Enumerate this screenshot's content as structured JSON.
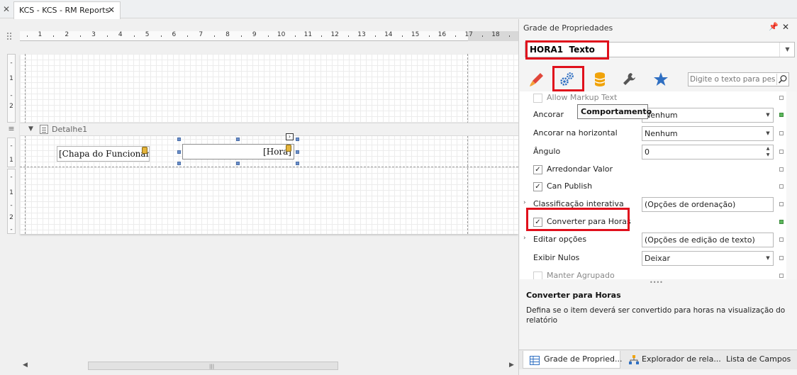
{
  "document_tab": {
    "label": "KCS - KCS - RM Reports",
    "close_glyph": "✕"
  },
  "ruler": {
    "numbers": [
      "1",
      "2",
      "3",
      "4",
      "5",
      "6",
      "7",
      "8",
      "9",
      "10",
      "11",
      "12",
      "13",
      "14",
      "15",
      "16",
      "17",
      "18"
    ]
  },
  "vruler": {
    "top_section": [
      "-",
      "1",
      "-",
      "2"
    ],
    "detail_section": [
      "-",
      "1"
    ],
    "bottom_section": [
      "-",
      "1",
      "-",
      "2",
      "-"
    ]
  },
  "designer": {
    "band_name": "Detalhe1",
    "field_employee": "[Chapa do Funcionário]",
    "field_hours": "[Hora]"
  },
  "properties": {
    "title": "Grade de Propriedades",
    "selected_object": "HORA1  Texto",
    "search_placeholder": "Digite o texto para pesquisar...",
    "tooltip": "Comportamento",
    "rows": {
      "allow_markup": "Allow Markup Text",
      "ancorar": {
        "label": "Ancorar",
        "value": "Nenhum"
      },
      "ancorar_h": {
        "label": "Ancorar na horizontal",
        "value": "Nenhum"
      },
      "angulo": {
        "label": "Ângulo",
        "value": "0"
      },
      "arredondar": "Arredondar Valor",
      "can_publish": "Can Publish",
      "classificacao": {
        "label": "Classificação interativa",
        "value": "(Opções de ordenação)"
      },
      "converter": "Converter para Horas",
      "editar": {
        "label": "Editar opções",
        "value": "(Opções de edição de texto)"
      },
      "exibir_nulos": {
        "label": "Exibir Nulos",
        "value": "Deixar"
      },
      "manter": "Manter Agrupado"
    },
    "description": {
      "title": "Converter para Horas",
      "text": "Defina se o item deverá ser convertido para horas na visualização do relatório"
    },
    "bottom_tabs": {
      "grid": "Grade de Propried...",
      "explorer": "Explorador de rela...",
      "fields": "Lista de Campos"
    }
  },
  "colors": {
    "highlight": "#e0101c",
    "accent": "#2f6fc2",
    "modified": "#5cb85c"
  },
  "icons": [
    "close-icon",
    "pin-icon",
    "dropdown-icon",
    "brush-icon",
    "gears-icon",
    "database-icon",
    "wrench-icon",
    "star-icon",
    "search-icon",
    "band-icon",
    "checkbox-icon",
    "scroll-arrow-icon"
  ]
}
